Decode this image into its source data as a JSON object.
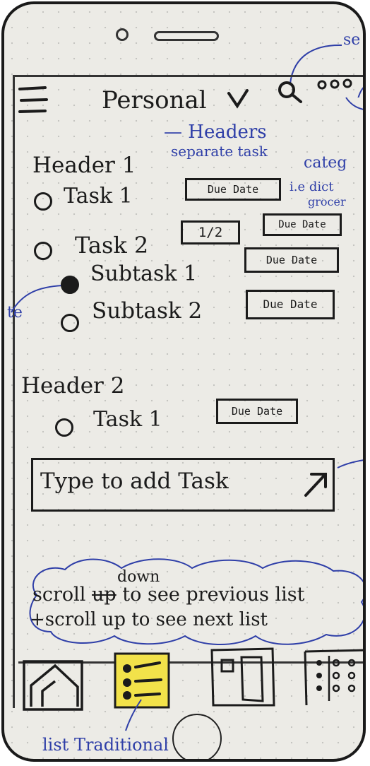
{
  "header": {
    "list_title": "Personal",
    "search_note": "se"
  },
  "annotations": {
    "headers": "Headers",
    "separate_task": "separate task",
    "categories": "categ",
    "ie": "i.e dict",
    "groceries": "grocer",
    "left_note": "te",
    "bottom_label": "list Traditional"
  },
  "list": {
    "header1": "Header 1",
    "task1": "Task 1",
    "task2": "Task 2",
    "task2_progress": "1/2",
    "subtask1": "Subtask 1",
    "subtask2": "Subtask 2",
    "header2": "Header 2",
    "h2_task1": "Task 1",
    "due_label": "Due Date"
  },
  "input": {
    "placeholder": "Type to add Task"
  },
  "scroll_note": {
    "line1_prefix": "scroll",
    "line1_word": "down",
    "line1_rest": "to see previous list",
    "line2": "+scroll up to see next list",
    "strike": "up"
  },
  "colors": {
    "ink": "#1b1b1b",
    "annotation_blue": "#2f3fa8",
    "highlight_yellow": "#f2e24a",
    "paper": "#ecebe6"
  },
  "icons": {
    "menu": "hamburger-menu-icon",
    "dropdown": "chevron-down-icon",
    "search": "search-icon",
    "more": "more-dots-icon",
    "submit": "expand-arrow-icon",
    "nav_home": "home-icon",
    "nav_list": "list-icon",
    "nav_doc": "document-icon",
    "nav_grid": "grid-icon"
  }
}
